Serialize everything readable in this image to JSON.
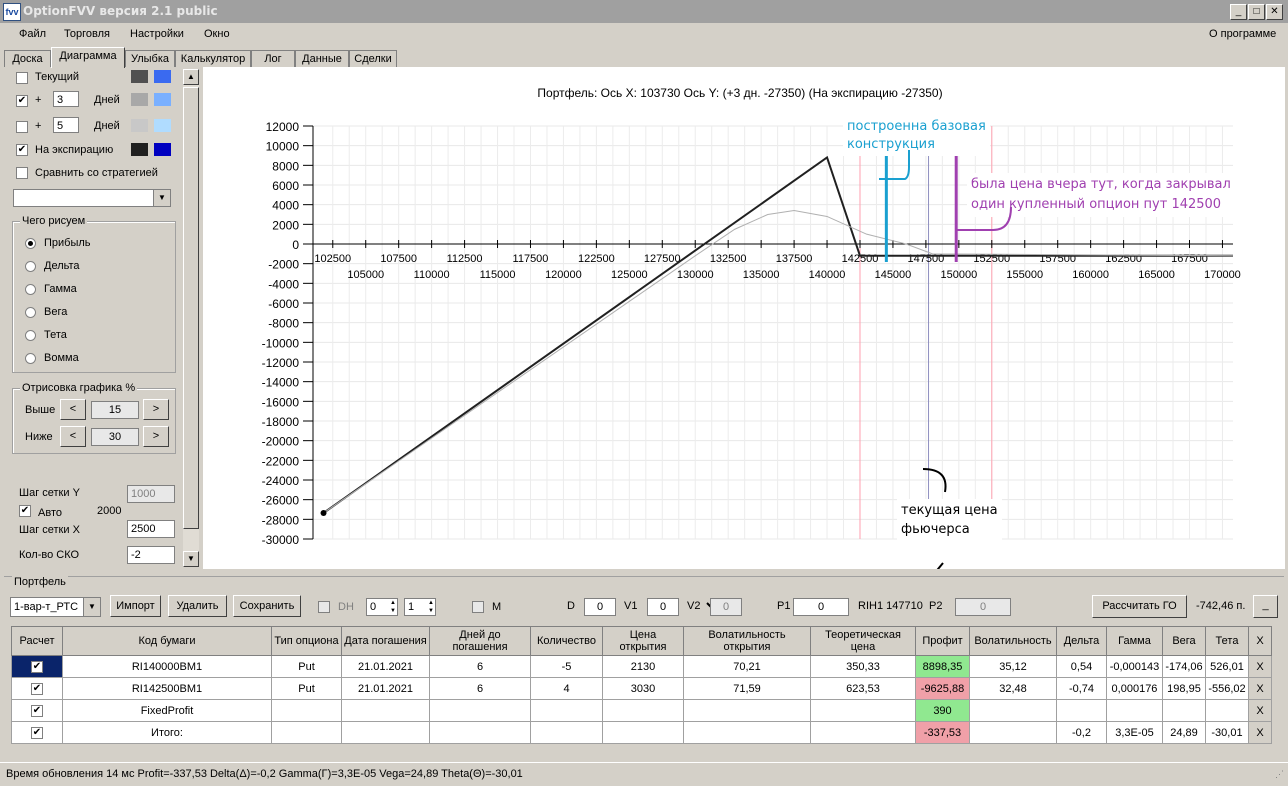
{
  "window": {
    "title": "OptionFVV версия 2.1 public"
  },
  "menu": {
    "items": [
      "Файл",
      "Торговля",
      "Настройки",
      "Окно"
    ],
    "about": "О программе"
  },
  "tabs": [
    "Доска",
    "Диаграмма",
    "Улыбка",
    "Калькулятор",
    "Лог",
    "Данные",
    "Сделки"
  ],
  "left": {
    "current_label": "Текущий",
    "plus1": "+",
    "days1_value": "3",
    "days1_label": "Дней",
    "plus2": "+",
    "days2_value": "5",
    "days2_label": "Дней",
    "expiry_label": "На экспирацию",
    "compare_label": "Сравнить со стратегией",
    "what_title": "Чего рисуем",
    "options": [
      "Прибыль",
      "Дельта",
      "Гамма",
      "Вега",
      "Тета",
      "Вомма"
    ],
    "draw_title": "Отрисовка графика %",
    "above_label": "Выше",
    "above_value": "15",
    "below_label": "Ниже",
    "below_value": "30",
    "prev": "<",
    "next": ">",
    "grid_y_label": "Шаг сетки Y",
    "grid_y_value": "1000",
    "auto_label": "Авто",
    "auto_value": "2000",
    "grid_x_label": "Шаг сетки X",
    "grid_x_value": "2500",
    "sko_label": "Кол-во СКО",
    "sko_value": "-2",
    "colors": {
      "current": [
        "#505050",
        "#3a6af0"
      ],
      "d1": [
        "#a8a8a8",
        "#7ab0ff"
      ],
      "d2": [
        "#c8c8c8",
        "#b0dcff"
      ],
      "expiry": [
        "#202020",
        "#0000c0"
      ]
    }
  },
  "chart_header": "Портфель:  Ось X:  103730 Ось Y:   (+3 дн.  -27350)   (На экспирацию  -27350)",
  "annotations": {
    "base": [
      "построенна базовая",
      "конструкция"
    ],
    "yesterday": [
      "была цена вчера тут, когда закрывал",
      "один купленный опцион пут 142500"
    ],
    "current": [
      "текущая цена",
      "фьючерса"
    ]
  },
  "chart_data": {
    "type": "line",
    "ylim": [
      -30000,
      12000
    ],
    "xlim": [
      101000,
      170800
    ],
    "yticks": [
      12000,
      10000,
      8000,
      6000,
      4000,
      2000,
      0,
      -2000,
      -4000,
      -6000,
      -8000,
      -10000,
      -12000,
      -14000,
      -16000,
      -18000,
      -20000,
      -22000,
      -24000,
      -26000,
      -28000,
      -30000
    ],
    "xticks_top": [
      "102500",
      "107500",
      "112500",
      "117500",
      "122500",
      "127500",
      "132500",
      "137500",
      "142500",
      "147500",
      "152500",
      "157500",
      "162500",
      "167500"
    ],
    "xticks_bottom": [
      "105000",
      "110000",
      "115000",
      "120000",
      "125000",
      "130000",
      "135000",
      "140000",
      "145000",
      "150000",
      "155000",
      "160000",
      "165000",
      "170000"
    ],
    "series": [
      {
        "values_x": [
          101800,
          140000,
          142500,
          170800
        ],
        "values_y": [
          -27350,
          8800,
          -1200,
          -1200
        ],
        "color": "#202020"
      },
      {
        "values_x": [
          101800,
          130000,
          133000,
          135500,
          137500,
          140000,
          143000,
          146000,
          148000,
          170800
        ],
        "values_y": [
          -27350,
          -1200,
          1500,
          3000,
          3400,
          2800,
          1000,
          0,
          -1000,
          -1200
        ],
        "color": "#b0b0b0"
      }
    ],
    "vlines": [
      {
        "x": 142500,
        "color": "#ffa0b0"
      },
      {
        "x": 147700,
        "color": "#9090c0"
      },
      {
        "x": 152500,
        "color": "#ffa0b0"
      }
    ],
    "markers": [
      {
        "x": 144500,
        "color": "#1aa0d0"
      },
      {
        "x": 149800,
        "color": "#a040b0"
      }
    ]
  },
  "portfolio": {
    "title": "Портфель",
    "select_value": "1-вар-т_РТС",
    "import": "Импорт",
    "delete": "Удалить",
    "save": "Сохранить",
    "dh": "DH",
    "dh_v1": "0",
    "dh_v2": "1",
    "m": "M",
    "d_label": "D",
    "d_value": "0",
    "v1_label": "V1",
    "v1_value": "0",
    "v2_label": "V2",
    "v2_value": "0",
    "p1_label": "P1",
    "p1_value": "0",
    "rih": "RIH1 147710",
    "p2_label": "P2",
    "p2_value": "0",
    "calc_go": "Рассчитать ГО",
    "go_value": "-742,46 п.",
    "min_btn": "_"
  },
  "table": {
    "headers": [
      "Расчет",
      "Код бумаги",
      "Тип опциона",
      "Дата погашения",
      "Дней до погашения",
      "Количество",
      "Цена открытия",
      "Волатильность открытия",
      "Теоретическая цена",
      "Профит",
      "Волатильность",
      "Дельта",
      "Гамма",
      "Вега",
      "Тета",
      "X"
    ],
    "rows": [
      [
        "✔",
        "RI140000BM1",
        "Put",
        "21.01.2021",
        "6",
        "-5",
        "2130",
        "70,21",
        "350,33",
        "8898,35",
        "35,12",
        "0,54",
        "-0,000143",
        "-174,06",
        "526,01",
        "X"
      ],
      [
        "✔",
        "RI142500BM1",
        "Put",
        "21.01.2021",
        "6",
        "4",
        "3030",
        "71,59",
        "623,53",
        "-9625,88",
        "32,48",
        "-0,74",
        "0,000176",
        "198,95",
        "-556,02",
        "X"
      ],
      [
        "✔",
        "FixedProfit",
        "",
        "",
        "",
        "",
        "",
        "",
        "",
        "390",
        "",
        "",
        "",
        "",
        "",
        "X"
      ],
      [
        "✔",
        "Итого:",
        "",
        "",
        "",
        "",
        "",
        "",
        "",
        "-337,53",
        "",
        "-0,2",
        "3,3E-05",
        "24,89",
        "-30,01",
        "X"
      ]
    ],
    "profit_colors": [
      "#90e890",
      "#f0a0a8",
      "#90e890",
      "#f0a0a8"
    ]
  },
  "status": "Время обновления 14 мс   Profit=-337,53 Delta(Δ)=-0,2 Gamma(Γ)=3,3E-05 Vega=24,89 Theta(Θ)=-30,01"
}
